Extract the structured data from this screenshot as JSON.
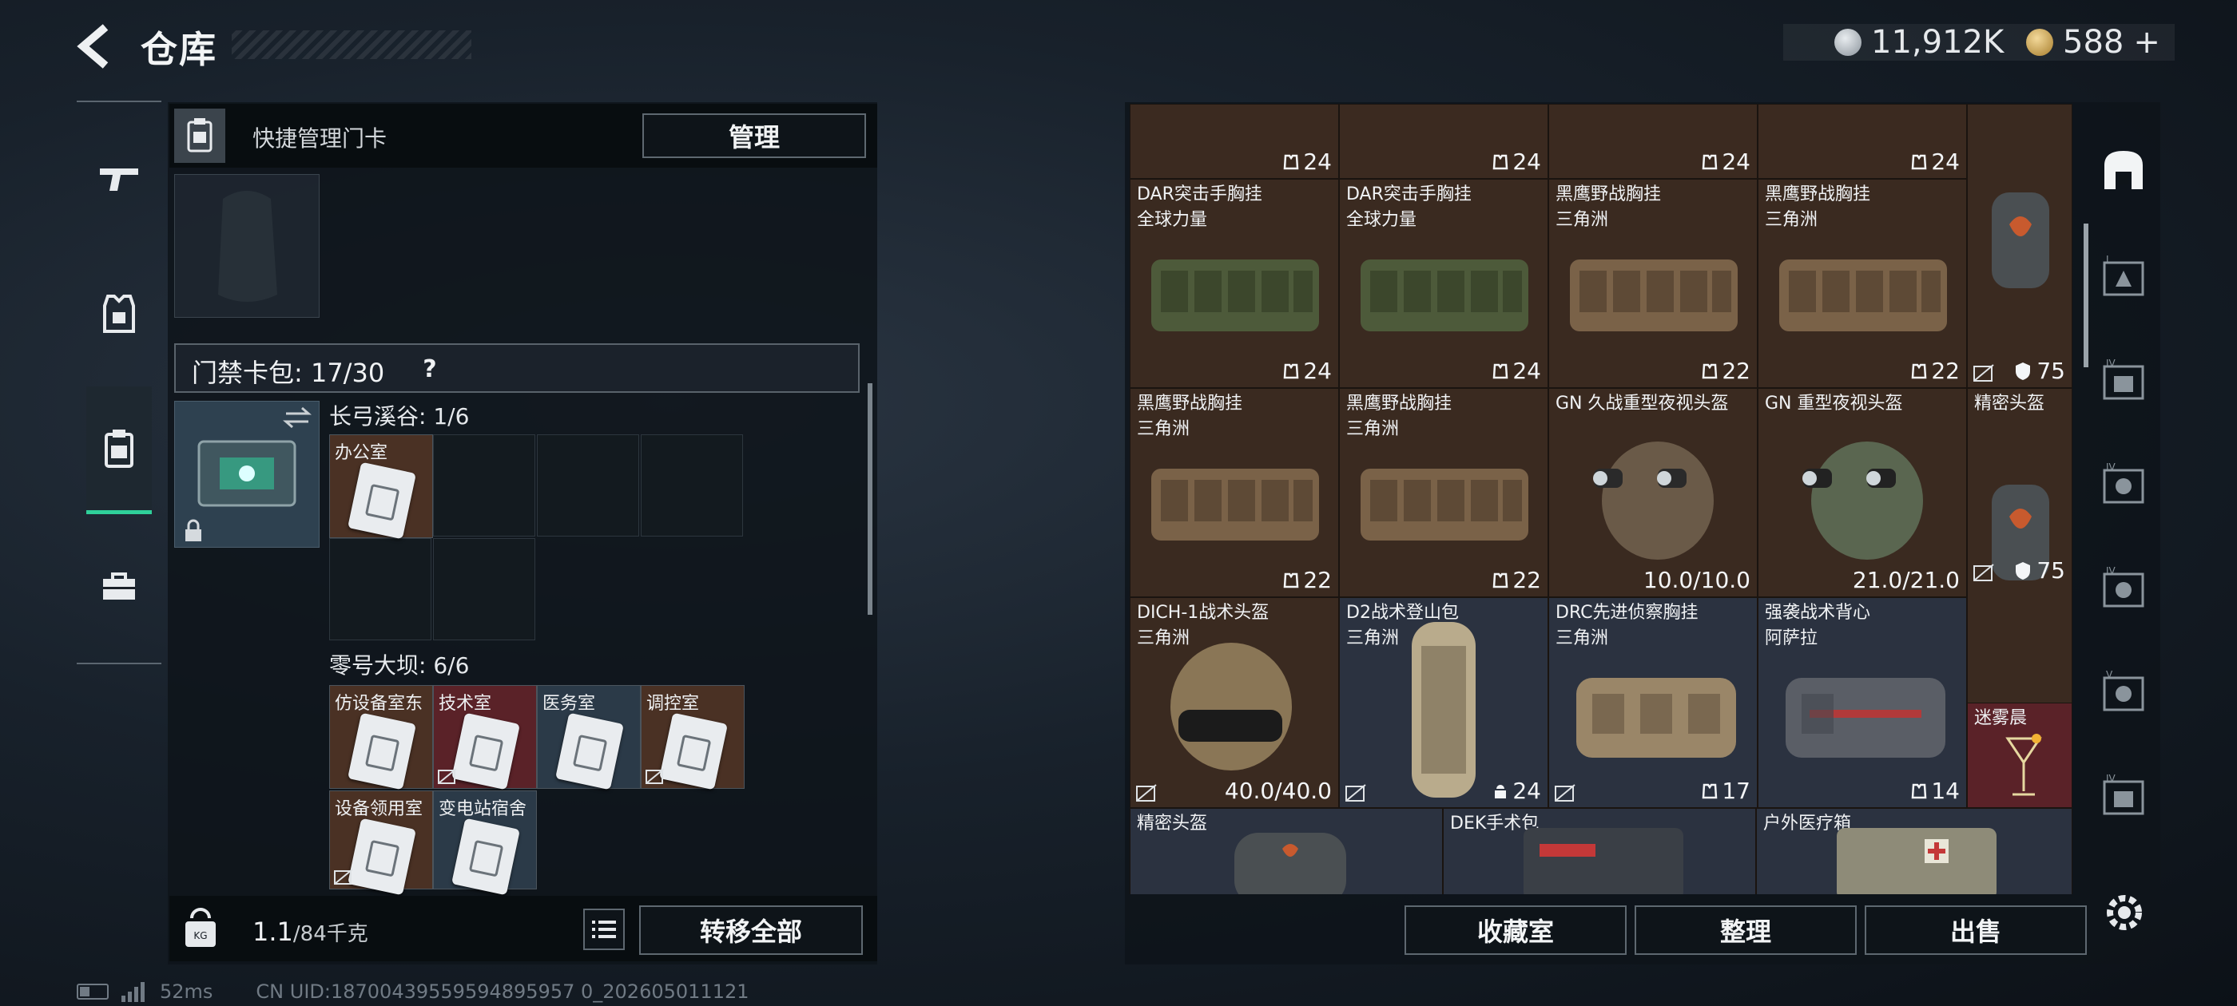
{
  "header": {
    "title": "仓库",
    "currency": {
      "silver": "11,912K",
      "gold": "588",
      "gold_plus": "+"
    }
  },
  "nav": {
    "items": [
      "weapons-icon",
      "armor-icon",
      "keycard-icon",
      "briefcase-icon"
    ],
    "active": 2
  },
  "left_panel": {
    "header_label": "快捷管理门卡",
    "manage_label": "管理",
    "keycard_bag_label": "门禁卡包: 17/30",
    "help_label": "?",
    "groups": [
      {
        "label": "长弓溪谷: 1/6",
        "cards": [
          {
            "name": "办公室"
          }
        ]
      },
      {
        "label": "零号大坝: 6/6",
        "cards": [
          {
            "name": "仿设备室东"
          },
          {
            "name": "技术室"
          },
          {
            "name": "医务室"
          },
          {
            "name": "调控室"
          },
          {
            "name": "设备领用室"
          },
          {
            "name": "变电站宿舍"
          }
        ]
      }
    ],
    "weight_value": "1.1",
    "weight_unit": "/84千克",
    "transfer_label": "转移全部"
  },
  "status_bar": {
    "ping": "52ms",
    "uid": "CN UID:18700439559594895957 0_202605011121"
  },
  "stash": {
    "row0_counts": [
      "24",
      "24",
      "24",
      "24"
    ],
    "items": [
      {
        "n1": "DAR突击手胸挂",
        "n2": "全球力量",
        "count": "24"
      },
      {
        "n1": "DAR突击手胸挂",
        "n2": "全球力量",
        "count": "24"
      },
      {
        "n1": "黑鹰野战胸挂",
        "n2": "三角洲",
        "count": "22"
      },
      {
        "n1": "黑鹰野战胸挂",
        "n2": "三角洲",
        "count": "22"
      },
      {
        "n1": "",
        "n2": "",
        "armor": "75"
      },
      {
        "n1": "黑鹰野战胸挂",
        "n2": "三角洲",
        "count": "22"
      },
      {
        "n1": "黑鹰野战胸挂",
        "n2": "三角洲",
        "count": "22"
      },
      {
        "n1": "GN 久战重型夜视头盔",
        "n2": "",
        "dur": "10.0/10.0"
      },
      {
        "n1": "GN 重型夜视头盔",
        "n2": "",
        "dur": "21.0/21.0"
      },
      {
        "n1": "精密头盔",
        "n2": "",
        "armor": "75"
      },
      {
        "n1": "DICH-1战术头盔",
        "n2": "三角洲",
        "dur": "40.0/40.0"
      },
      {
        "n1": "D2战术登山包",
        "n2": "三角洲",
        "count": "24"
      },
      {
        "n1": "DRC先进侦察胸挂",
        "n2": "三角洲",
        "count": "17"
      },
      {
        "n1": "强袭战术背心",
        "n2": "阿萨拉",
        "count": "14"
      },
      {
        "n1": "迷雾晨",
        "n2": ""
      },
      {
        "n1": "精密头盔",
        "n2": ""
      },
      {
        "n1": "DEK手术包",
        "n2": ""
      },
      {
        "n1": "户外医疗箱",
        "n2": ""
      }
    ]
  },
  "bottom": {
    "collection": "收藏室",
    "sort": "整理",
    "sell": "出售"
  },
  "side_tabs": [
    "home-icon",
    "tab-I",
    "tab-II",
    "tab-III",
    "tab-IV",
    "tab-V",
    "tab-VI"
  ],
  "colors": {
    "accent": "#2fd09a",
    "brown_cell": "#4a3124",
    "slate_cell": "#2b3240"
  }
}
